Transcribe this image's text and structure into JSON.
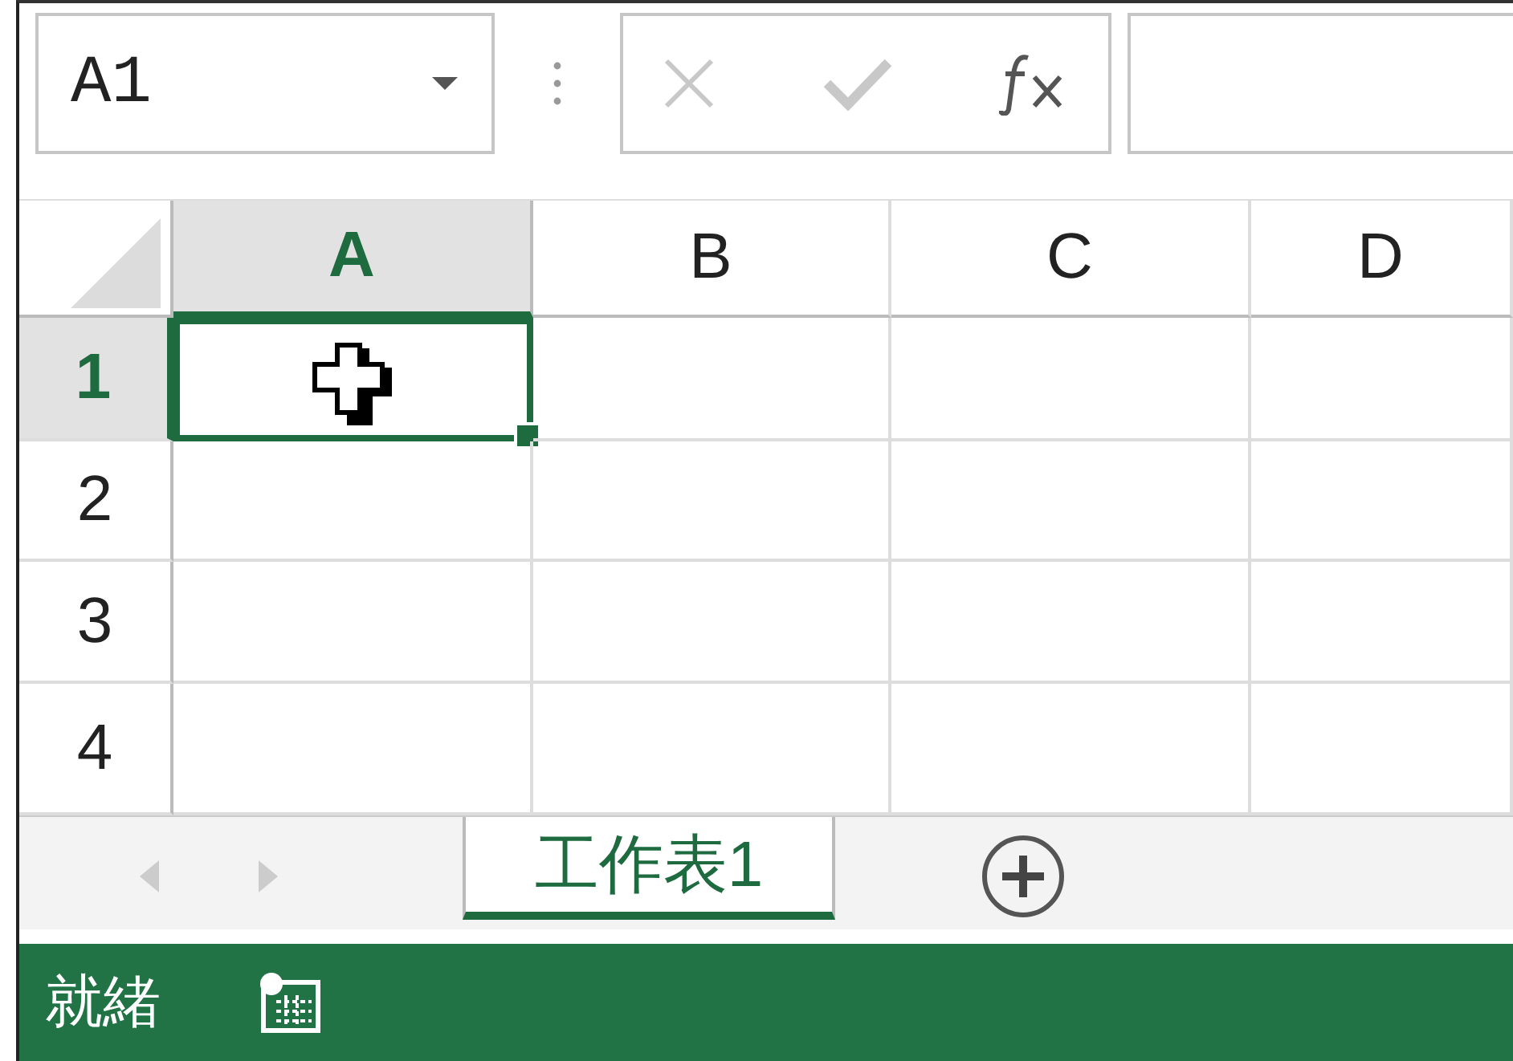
{
  "name_box": {
    "value": "A1"
  },
  "formula_buttons": [
    {
      "kind": "cancel",
      "disabled": true
    },
    {
      "kind": "enter",
      "disabled": true
    },
    {
      "kind": "function",
      "disabled": false
    }
  ],
  "columns": [
    {
      "label": "A",
      "selected": true
    },
    {
      "label": "B",
      "selected": false
    },
    {
      "label": "C",
      "selected": false
    },
    {
      "label": "D",
      "selected": false
    }
  ],
  "rows": [
    {
      "label": "1",
      "selected": true
    },
    {
      "label": "2",
      "selected": false
    },
    {
      "label": "3",
      "selected": false
    },
    {
      "label": "4",
      "selected": false
    }
  ],
  "sheet_tabs": [
    {
      "label": "工作表1",
      "selected": true
    }
  ],
  "status_bar": {
    "text": "就緒"
  }
}
